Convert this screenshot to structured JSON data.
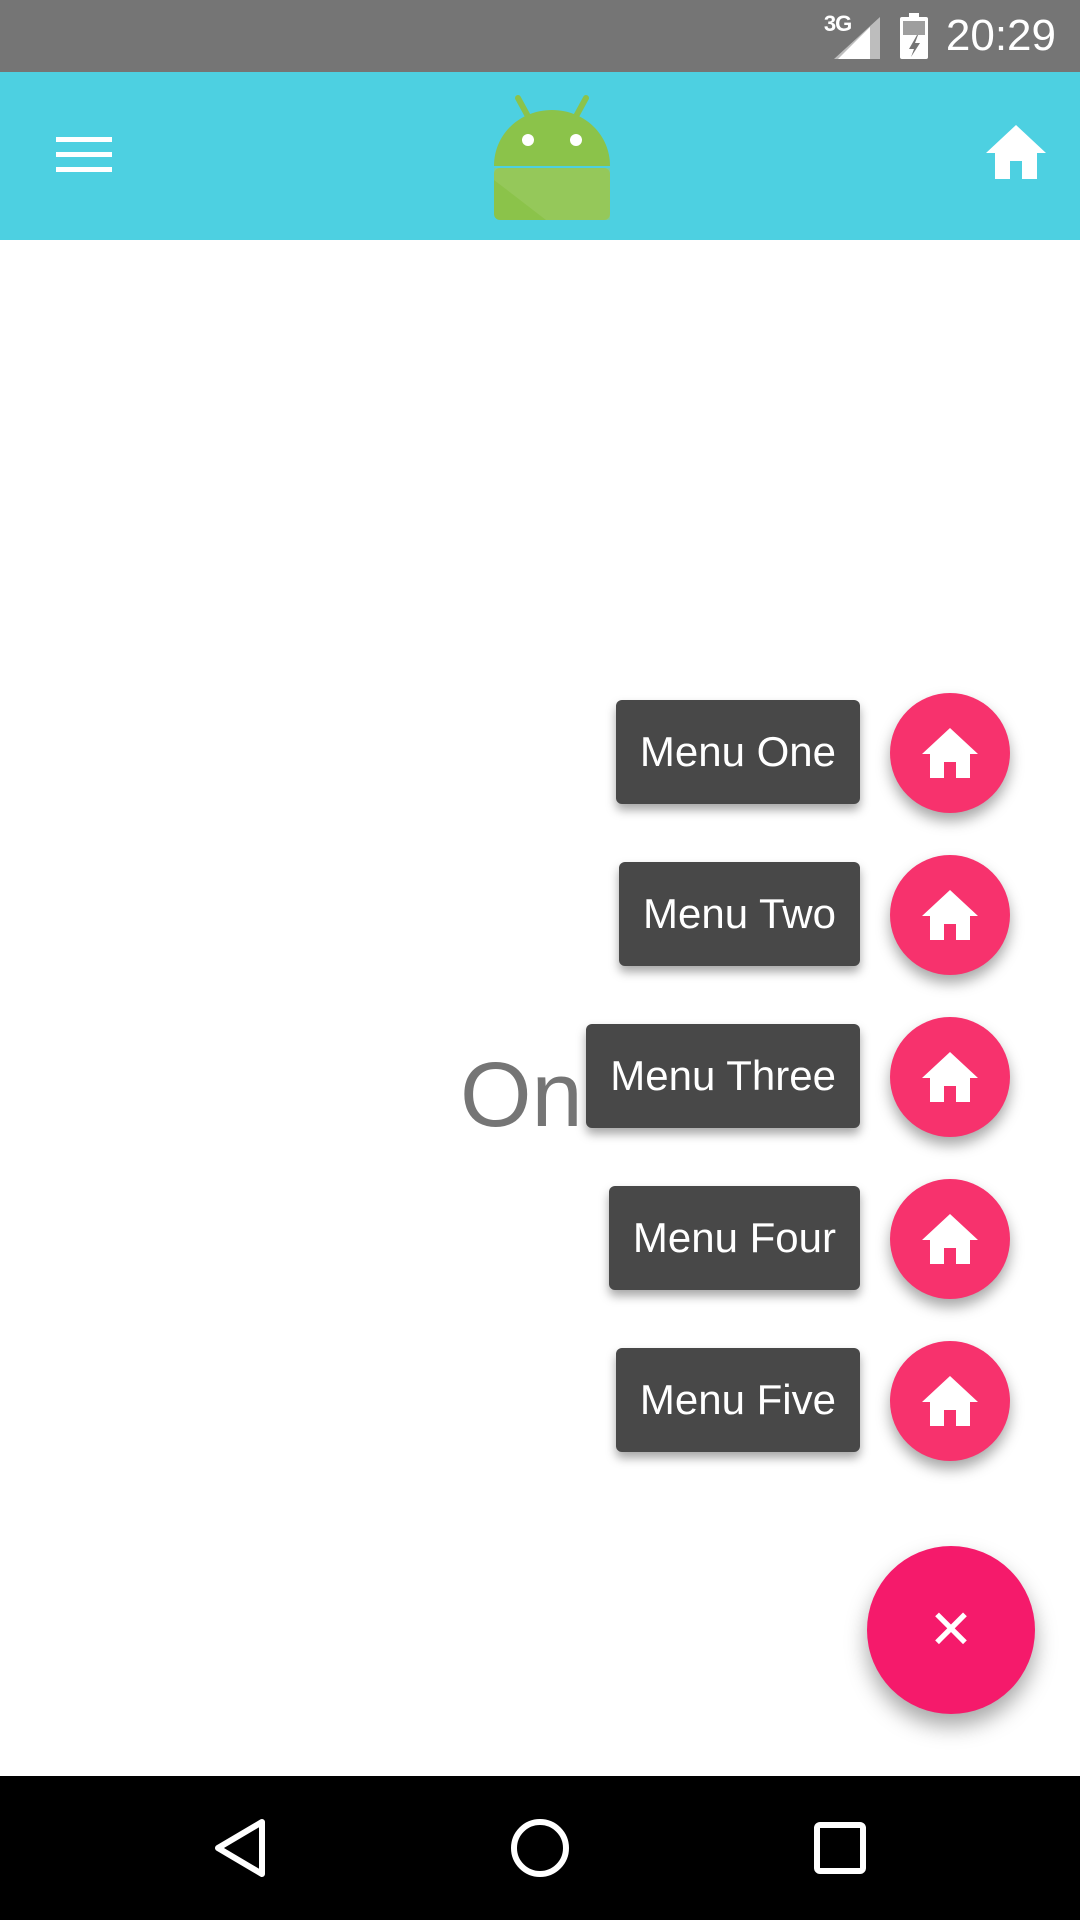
{
  "status_bar": {
    "network_type": "3G",
    "time": "20:29",
    "icons": [
      "signal-icon",
      "battery-icon"
    ]
  },
  "app_bar": {
    "background_color": "#4dd0e1",
    "left_icon": "hamburger-menu-icon",
    "logo": "android-logo",
    "right_icon": "home-icon"
  },
  "content": {
    "text": "One"
  },
  "fab_menu": {
    "items": [
      {
        "label": "Menu One",
        "icon": "home-icon"
      },
      {
        "label": "Menu Two",
        "icon": "home-icon"
      },
      {
        "label": "Menu Three",
        "icon": "home-icon"
      },
      {
        "label": "Menu Four",
        "icon": "home-icon"
      },
      {
        "label": "Menu Five",
        "icon": "home-icon"
      }
    ],
    "main_button_icon": "close-icon",
    "main_button_glyph": "✕",
    "accent_color": "#f51a6b",
    "label_background": "#484848"
  },
  "nav_bar": {
    "buttons": [
      "back-icon",
      "home-circle-icon",
      "recents-icon"
    ]
  }
}
